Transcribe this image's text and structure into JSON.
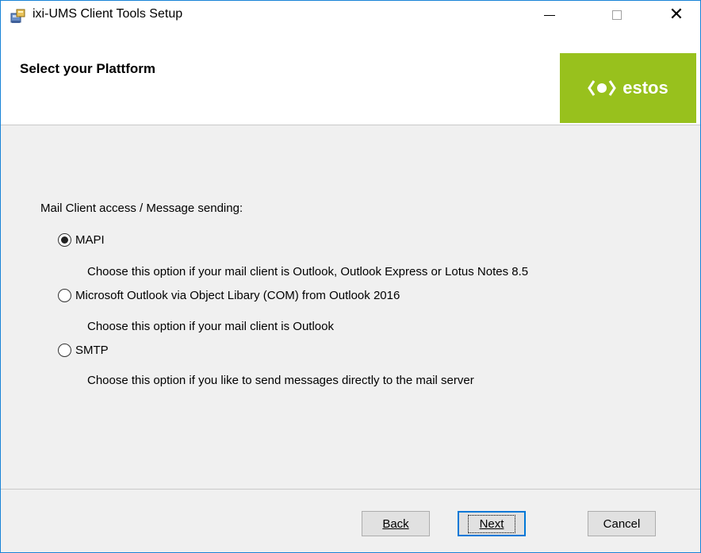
{
  "window": {
    "title": "ixi-UMS Client Tools Setup",
    "minimize_symbol": "—",
    "maximize_symbol": "☐",
    "close_symbol": "✕"
  },
  "banner": {
    "title": "Select your Plattform",
    "logo_text": "estos",
    "logo_color": "#98c11d"
  },
  "form": {
    "section_label": "Mail Client access / Message sending:",
    "selected": "mapi",
    "options": [
      {
        "id": "mapi",
        "label": "MAPI",
        "description": "Choose this option if your mail client is Outlook, Outlook Express or Lotus Notes 8.5",
        "selected": true
      },
      {
        "id": "com",
        "label": "Microsoft Outlook via Object Libary (COM) from Outlook 2016",
        "description": "Choose this option if your mail client is Outlook",
        "selected": false
      },
      {
        "id": "smtp",
        "label": "SMTP",
        "description": "Choose this option if you like to send messages directly to the mail server",
        "selected": false
      }
    ]
  },
  "buttons": {
    "back": "Back",
    "next": "Next",
    "cancel": "Cancel"
  },
  "colors": {
    "accent": "#0078d7",
    "window_border": "#1883d7"
  },
  "icons": {
    "app": "installer-package-icon",
    "logo": "estos-logo-mark"
  }
}
